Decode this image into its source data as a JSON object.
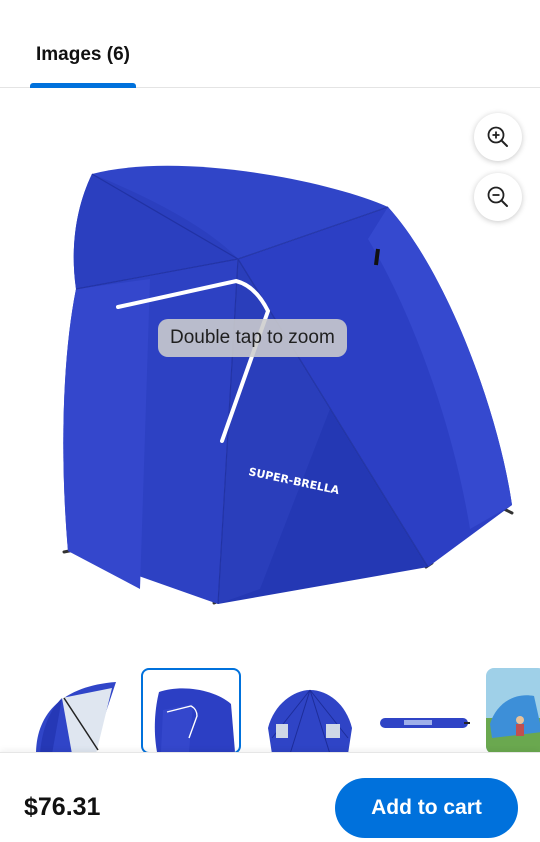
{
  "tabs": [
    {
      "label": "Images (6)",
      "selected": true
    }
  ],
  "viewer": {
    "hint": "Double tap to zoom",
    "image_icon": "blue-sport-umbrella-shelter",
    "brand_print": "SUPER-BRELLA",
    "zoom_in_icon": "zoom-in-icon",
    "zoom_out_icon": "zoom-out-icon"
  },
  "thumbnails": [
    {
      "icon": "umbrella-side-view",
      "selected": false
    },
    {
      "icon": "umbrella-front-view",
      "selected": true
    },
    {
      "icon": "umbrella-open-view",
      "selected": false
    },
    {
      "icon": "umbrella-carry-bag",
      "selected": false
    },
    {
      "icon": "umbrella-beach-scene",
      "selected": false
    }
  ],
  "purchase": {
    "price": "$76.31",
    "add_to_cart": "Add to cart"
  },
  "colors": {
    "accent": "#0071dc",
    "umbrella_blue": "#2a3dc0"
  }
}
